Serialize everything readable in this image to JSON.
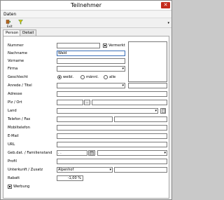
{
  "window": {
    "title": "Teilnehmer",
    "close_glyph": "✕"
  },
  "menu": {
    "daten": "Daten"
  },
  "toolbar": {
    "exit_label": "Exit",
    "exit_icon": "door-icon",
    "filter_icon": "filter-icon",
    "more_glyph": "▾"
  },
  "tabs": [
    {
      "label": "Person",
      "active": true
    },
    {
      "label": "Detail",
      "active": false
    }
  ],
  "form": {
    "nummer": {
      "label": "Nummer",
      "value": ""
    },
    "vermerkt": {
      "label": "Vermerkt",
      "checked": true
    },
    "nachname": {
      "label": "Nachname",
      "value": "Wald"
    },
    "vorname": {
      "label": "Vorname",
      "value": ""
    },
    "firma": {
      "label": "Firma",
      "value": ""
    },
    "geschlecht": {
      "label": "Geschlecht",
      "options": [
        "weibl.",
        "männl.",
        "alle"
      ],
      "selected": "weibl."
    },
    "anrede": {
      "label": "Anrede / Titel",
      "value": "",
      "titel": ""
    },
    "adresse": {
      "label": "Adresse",
      "value": ""
    },
    "plz_ort": {
      "label": "Plz / Ort",
      "plz": "",
      "ort": "",
      "lookup_glyph": "..."
    },
    "land": {
      "label": "Land",
      "value": ""
    },
    "telefon": {
      "label": "Telefon / Fax",
      "telefon": "",
      "fax": ""
    },
    "mobiltelefon": {
      "label": "Mobiltelefon",
      "value": ""
    },
    "email": {
      "label": "E-Mail",
      "value": ""
    },
    "url": {
      "label": "URL",
      "value": ""
    },
    "gebdat": {
      "label": "Geb.dat. / Familienstand",
      "value": ". .",
      "familienstand": ""
    },
    "profil": {
      "label": "Profil",
      "value": ""
    },
    "unterkunft": {
      "label": "Unterkunft / Zusatz",
      "value": "Alpenhof",
      "zusatz": ""
    },
    "rabatt": {
      "label": "Rabatt",
      "value": "-1,00 %"
    },
    "werbung": {
      "label": "Werbung",
      "checked": true
    }
  }
}
